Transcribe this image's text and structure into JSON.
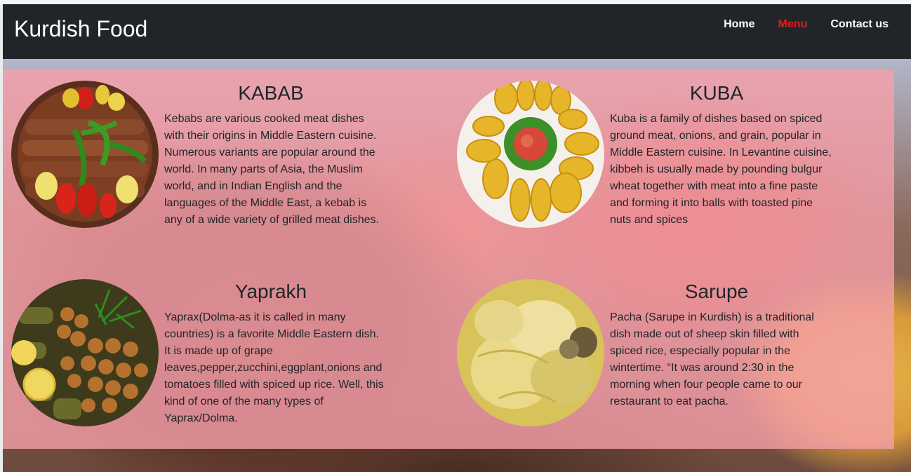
{
  "brand": "Kurdish Food",
  "nav": {
    "home": "Home",
    "menu": "Menu",
    "contact": "Contact us",
    "active_color": "#e21a1a"
  },
  "dishes": [
    {
      "title": "KABAB",
      "image_icon": "kabab-photo",
      "description": "Kebabs are various cooked meat dishes with their origins in Middle Eastern cuisine. Numerous variants are popular around the world. In many parts of Asia, the Muslim world, and in Indian English and the languages of the Middle East, a kebab is any of a wide variety of grilled meat dishes."
    },
    {
      "title": "KUBA",
      "image_icon": "kuba-photo",
      "description": "Kuba is a family of dishes based on spiced ground meat, onions, and grain, popular in Middle Eastern cuisine. In Levantine cuisine, kibbeh is usually made by pounding bulgur wheat together with meat into a fine paste and forming it into balls with toasted pine nuts and spices"
    },
    {
      "title": "Yaprakh",
      "image_icon": "yaprakh-photo",
      "description": "Yaprax(Dolma-as it is called in many countries) is a favorite Middle Eastern dish. It is made up of grape leaves,pepper,zucchini,eggplant,onions and tomatoes filled with spiced up rice. Well, this kind of one of the many types of Yaprax/Dolma."
    },
    {
      "title": "Sarupe",
      "image_icon": "sarupe-photo",
      "description": "Pacha (Sarupe in Kurdish) is a traditional dish made out of sheep skin filled with spiced rice, especially popular in the wintertime. “It was around 2:30 in the morning when four people came to our restaurant to eat pacha."
    }
  ]
}
